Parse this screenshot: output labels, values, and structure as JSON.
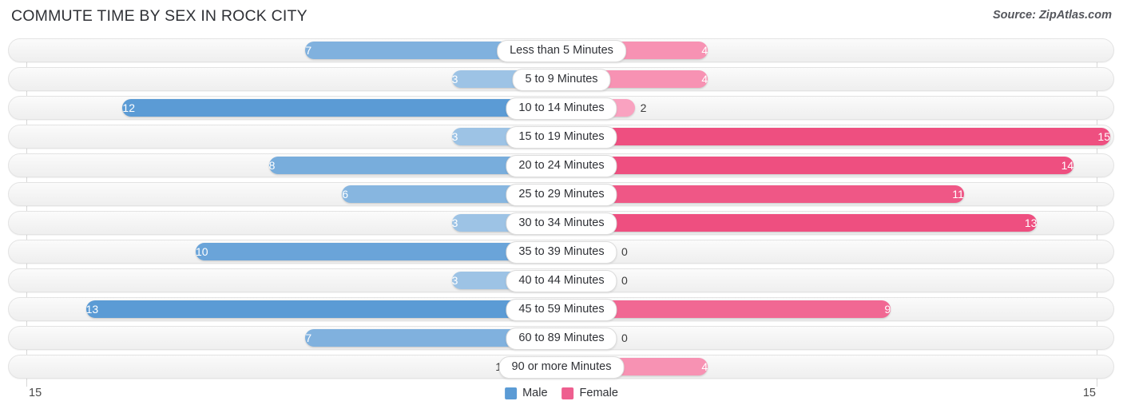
{
  "header": {
    "title": "COMMUTE TIME BY SEX IN ROCK CITY",
    "source": "Source: ZipAtlas.com"
  },
  "legend": {
    "male_label": "Male",
    "female_label": "Female",
    "male_color": "#5b9bd5",
    "female_color": "#ee5f8f"
  },
  "axis": {
    "left_label": "15",
    "right_label": "15"
  },
  "chart_data": {
    "type": "bar",
    "title": "COMMUTE TIME BY SEX IN ROCK CITY",
    "subtitle": "",
    "orientation": "horizontal-diverging",
    "xlabel": "",
    "ylabel": "",
    "xlim": [
      15,
      15
    ],
    "grid": true,
    "legend_position": "bottom-center",
    "categories": [
      "Less than 5 Minutes",
      "5 to 9 Minutes",
      "10 to 14 Minutes",
      "15 to 19 Minutes",
      "20 to 24 Minutes",
      "25 to 29 Minutes",
      "30 to 34 Minutes",
      "35 to 39 Minutes",
      "40 to 44 Minutes",
      "45 to 59 Minutes",
      "60 to 89 Minutes",
      "90 or more Minutes"
    ],
    "series": [
      {
        "name": "Male",
        "color": "#5b9bd5",
        "values": [
          7,
          3,
          12,
          3,
          8,
          6,
          3,
          10,
          3,
          13,
          7,
          1
        ]
      },
      {
        "name": "Female",
        "color": "#ee5f8f",
        "values": [
          4,
          4,
          2,
          15,
          14,
          11,
          13,
          0,
          0,
          9,
          0,
          4
        ]
      }
    ]
  }
}
